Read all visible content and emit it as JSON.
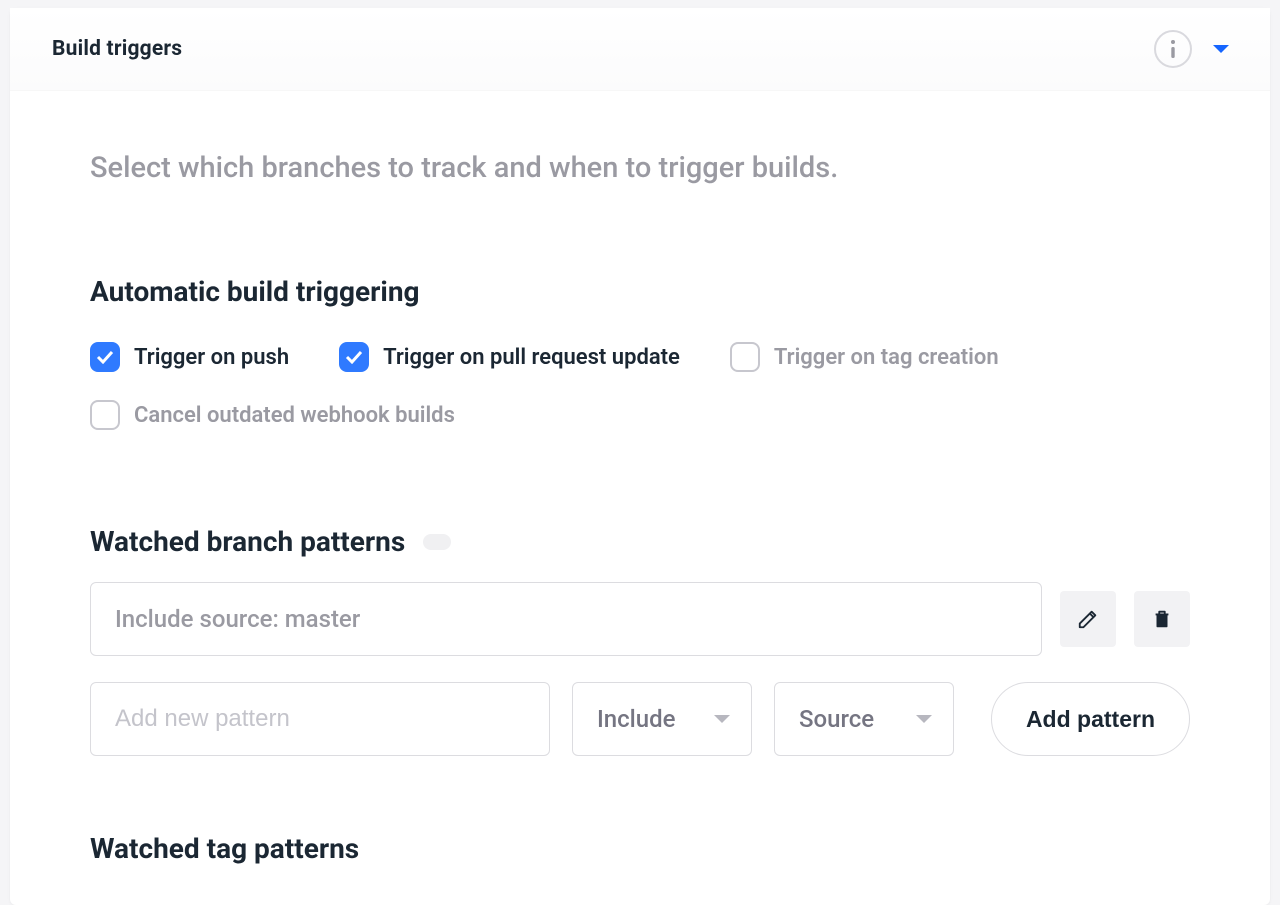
{
  "header": {
    "title": "Build triggers"
  },
  "intro": "Select which branches to track and when to trigger builds.",
  "sections": {
    "automatic": {
      "title": "Automatic build triggering",
      "checkboxes": [
        {
          "label": "Trigger on push",
          "checked": true
        },
        {
          "label": "Trigger on pull request update",
          "checked": true
        },
        {
          "label": "Trigger on tag creation",
          "checked": false
        },
        {
          "label": "Cancel outdated webhook builds",
          "checked": false
        }
      ]
    },
    "branch_patterns": {
      "title": "Watched branch patterns",
      "patterns": [
        {
          "display": "Include source: master"
        }
      ],
      "new_pattern": {
        "placeholder": "Add new pattern",
        "filter": "Include",
        "target": "Source",
        "button": "Add pattern"
      }
    },
    "tag_patterns": {
      "title": "Watched tag patterns"
    }
  }
}
